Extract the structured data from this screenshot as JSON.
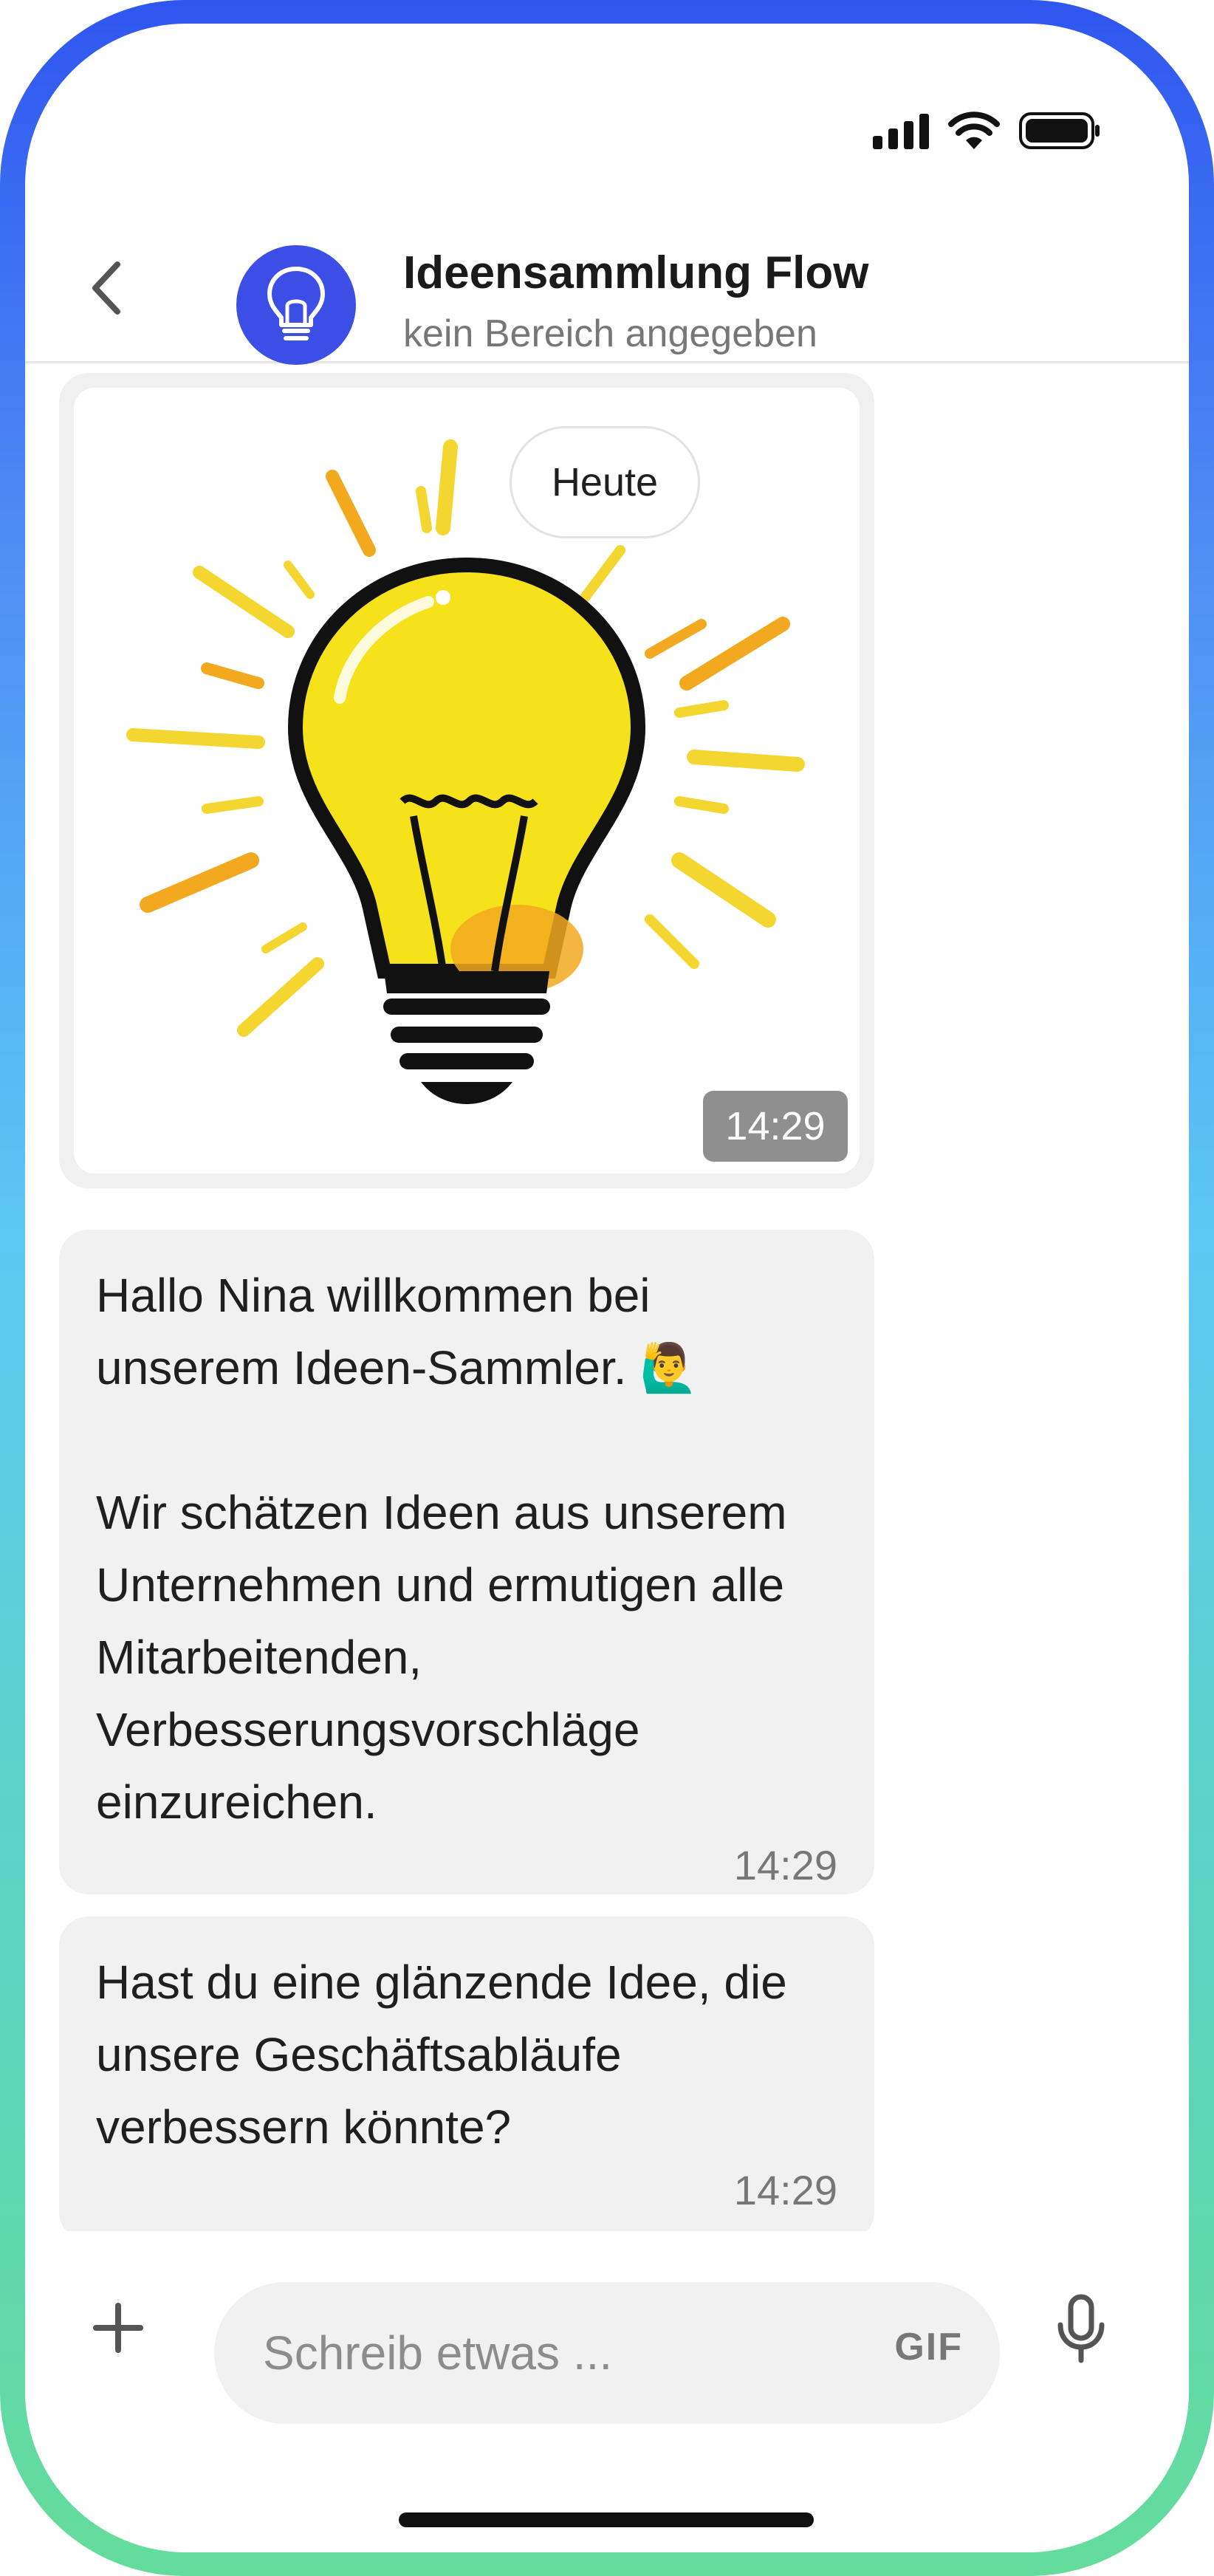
{
  "status_bar": {
    "icons": [
      "cellular-signal-icon",
      "wifi-icon",
      "battery-icon"
    ]
  },
  "header": {
    "back_icon": "chevron-left-icon",
    "avatar_icon": "lightbulb-icon",
    "avatar_color": "#3c4ee6",
    "title": "Ideensammlung Flow",
    "subtitle": "kein Bereich angegeben"
  },
  "chat": {
    "date_label": "Heute",
    "image_message": {
      "image": "lightbulb-illustration",
      "time": "14:29"
    },
    "messages": [
      {
        "text": "Hallo Nina willkommen bei unserem Ideen-Sammler. 🙋‍♂️\n\nWir schätzen Ideen aus unserem Unternehmen und ermutigen alle Mitarbeitenden, Verbesserungsvorschläge einzureichen.",
        "time": "14:29"
      },
      {
        "text": "Hast du eine glänzende Idee, die unsere Geschäftsabläufe verbessern könnte?",
        "time": "14:29"
      }
    ]
  },
  "composer": {
    "add_icon": "plus-icon",
    "placeholder": "Schreib etwas ...",
    "gif_label": "GIF",
    "mic_icon": "microphone-icon"
  },
  "colors": {
    "frame_top": "#2f56f0",
    "frame_middle": "#5cc8f4",
    "frame_bottom": "#64dc9a",
    "bubble_bg": "#f1f1f1"
  }
}
